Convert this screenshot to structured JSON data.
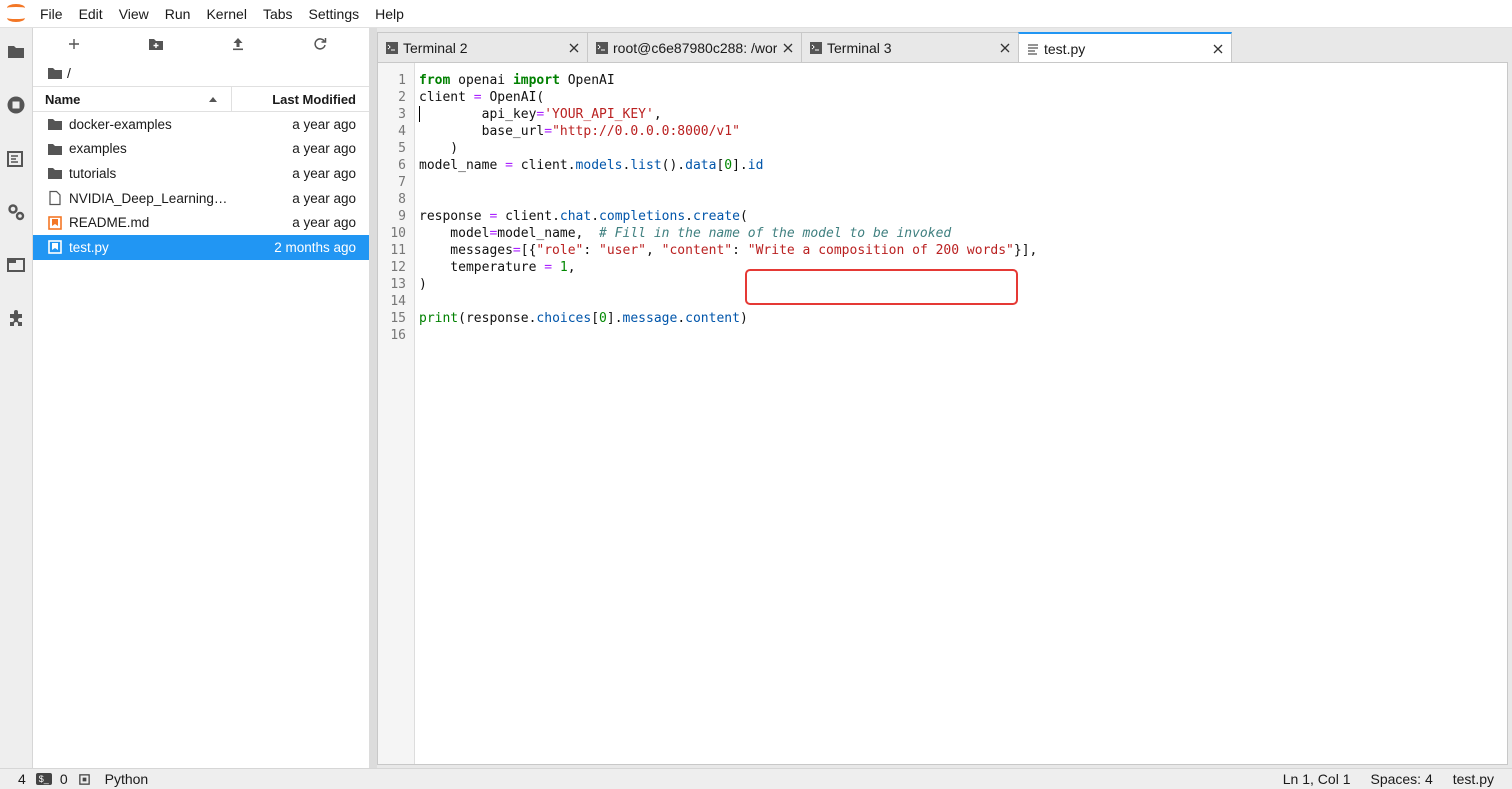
{
  "menu": [
    "File",
    "Edit",
    "View",
    "Run",
    "Kernel",
    "Tabs",
    "Settings",
    "Help"
  ],
  "activity_icons": [
    "folder-icon",
    "running-icon",
    "commands-icon",
    "property-inspector-icon",
    "tabs-icon",
    "extension-icon"
  ],
  "filebrowser": {
    "toolbar": [
      "new-launcher-icon",
      "new-folder-icon",
      "upload-icon",
      "refresh-icon"
    ],
    "path": "/",
    "header": {
      "name": "Name",
      "modified": "Last Modified"
    },
    "files": [
      {
        "name": "docker-examples",
        "type": "folder",
        "modified": "a year ago"
      },
      {
        "name": "examples",
        "type": "folder",
        "modified": "a year ago"
      },
      {
        "name": "tutorials",
        "type": "folder",
        "modified": "a year ago"
      },
      {
        "name": "NVIDIA_Deep_Learning_...",
        "type": "file",
        "modified": "a year ago"
      },
      {
        "name": "README.md",
        "type": "markdown",
        "modified": "a year ago"
      },
      {
        "name": "test.py",
        "type": "python",
        "modified": "2 months ago",
        "selected": true
      }
    ]
  },
  "tabs": [
    {
      "label": "Terminal 2",
      "icon": "terminal-icon"
    },
    {
      "label": "root@c6e87980c288: /wor",
      "icon": "terminal-icon"
    },
    {
      "label": "Terminal 3",
      "icon": "terminal-icon"
    },
    {
      "label": "test.py",
      "icon": "text-file-icon",
      "active": true
    }
  ],
  "line_numbers": [
    "1",
    "2",
    "3",
    "4",
    "5",
    "6",
    "7",
    "8",
    "9",
    "10",
    "11",
    "12",
    "13",
    "14",
    "15",
    "16"
  ],
  "code": {
    "l1_from": "from",
    "l1_mod": " openai ",
    "l1_import": "import",
    "l1_name": " OpenAI",
    "l2_a": "client ",
    "l2_eq": "=",
    "l2_b": " OpenAI(",
    "l3_a": "        api_key",
    "l3_eq": "=",
    "l3_s": "'YOUR_API_KEY'",
    "l3_b": ",",
    "l4_a": "        base_url",
    "l4_eq": "=",
    "l4_s": "\"http://0.0.0.0:8000/v1\"",
    "l5": "    )",
    "l6_a": "model_name ",
    "l6_eq": "=",
    "l6_b": " client.",
    "l6_c": "models",
    "l6_d": ".",
    "l6_e": "list",
    "l6_f": "().",
    "l6_g": "data",
    "l6_h": "[",
    "l6_n": "0",
    "l6_i": "].",
    "l6_j": "id",
    "l9_a": "response ",
    "l9_eq": "=",
    "l9_b": " client.",
    "l9_c": "chat",
    "l9_d": ".",
    "l9_e": "completions",
    "l9_f": ".",
    "l9_g": "create",
    "l9_h": "(",
    "l10_a": "    model",
    "l10_eq": "=",
    "l10_b": "model_name,  ",
    "l10_c": "# Fill in the name of the model to be invoked",
    "l11_a": "    messages",
    "l11_eq": "=",
    "l11_b": "[{",
    "l11_s1": "\"role\"",
    "l11_c": ": ",
    "l11_s2": "\"user\"",
    "l11_d": ", ",
    "l11_s3": "\"content\"",
    "l11_e": ": ",
    "l11_s4": "\"Write a composition of 200 words\"",
    "l11_f": "}],",
    "l12_a": "    temperature ",
    "l12_eq": "=",
    "l12_b": " ",
    "l12_n": "1",
    "l12_c": ",",
    "l13": ")",
    "l15_a": "print",
    "l15_b": "(response.",
    "l15_c": "choices",
    "l15_d": "[",
    "l15_n": "0",
    "l15_e": "].",
    "l15_f": "message",
    "l15_g": ".",
    "l15_h": "content",
    "l15_i": ")"
  },
  "status": {
    "left_count": "4",
    "terminals": "0",
    "kernel": "Python",
    "position": "Ln 1, Col 1",
    "spaces": "Spaces: 4",
    "file": "test.py"
  }
}
